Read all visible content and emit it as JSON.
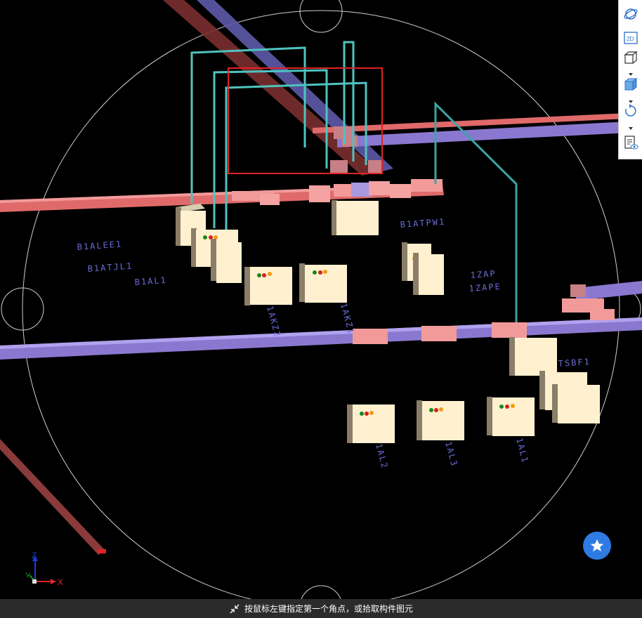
{
  "status_bar": {
    "prompt": "按鼠标左键指定第一个角点，或拾取构件图元",
    "icon": "shrink-arrows-icon"
  },
  "toolbar": {
    "items": [
      {
        "name": "orbit-3d-icon"
      },
      {
        "name": "view-2d-icon",
        "label": "2D"
      },
      {
        "name": "wireframe-cube-icon"
      },
      {
        "name": "solid-cube-icon"
      },
      {
        "name": "rotate-icon"
      },
      {
        "name": "display-settings-icon"
      }
    ]
  },
  "floating_button": {
    "icon": "star-icon"
  },
  "axes": {
    "x": "X",
    "y": "Y",
    "z": "Z"
  },
  "scene_labels": {
    "b1alee1": "B1ALEE1",
    "b1atjl1": "B1ATJL1",
    "b1al1": "B1AL1",
    "b1atpw1": "B1ATPW1",
    "zap": "1ZAP",
    "zape": "1ZAPE",
    "sbf": "TSBF1",
    "v1": "1AKZ2",
    "v2": "1AKZ1",
    "v3": "1AL2",
    "v4": "1AL3",
    "v5": "1AL1"
  },
  "colors": {
    "background": "#000000",
    "pipe_red": "#e06a6a",
    "pipe_purple": "#8a78d0",
    "conduit_teal": "#4fc3c0",
    "cabinet": "#fff1cf",
    "selection": "#e02424",
    "accent": "#2f7be4"
  }
}
